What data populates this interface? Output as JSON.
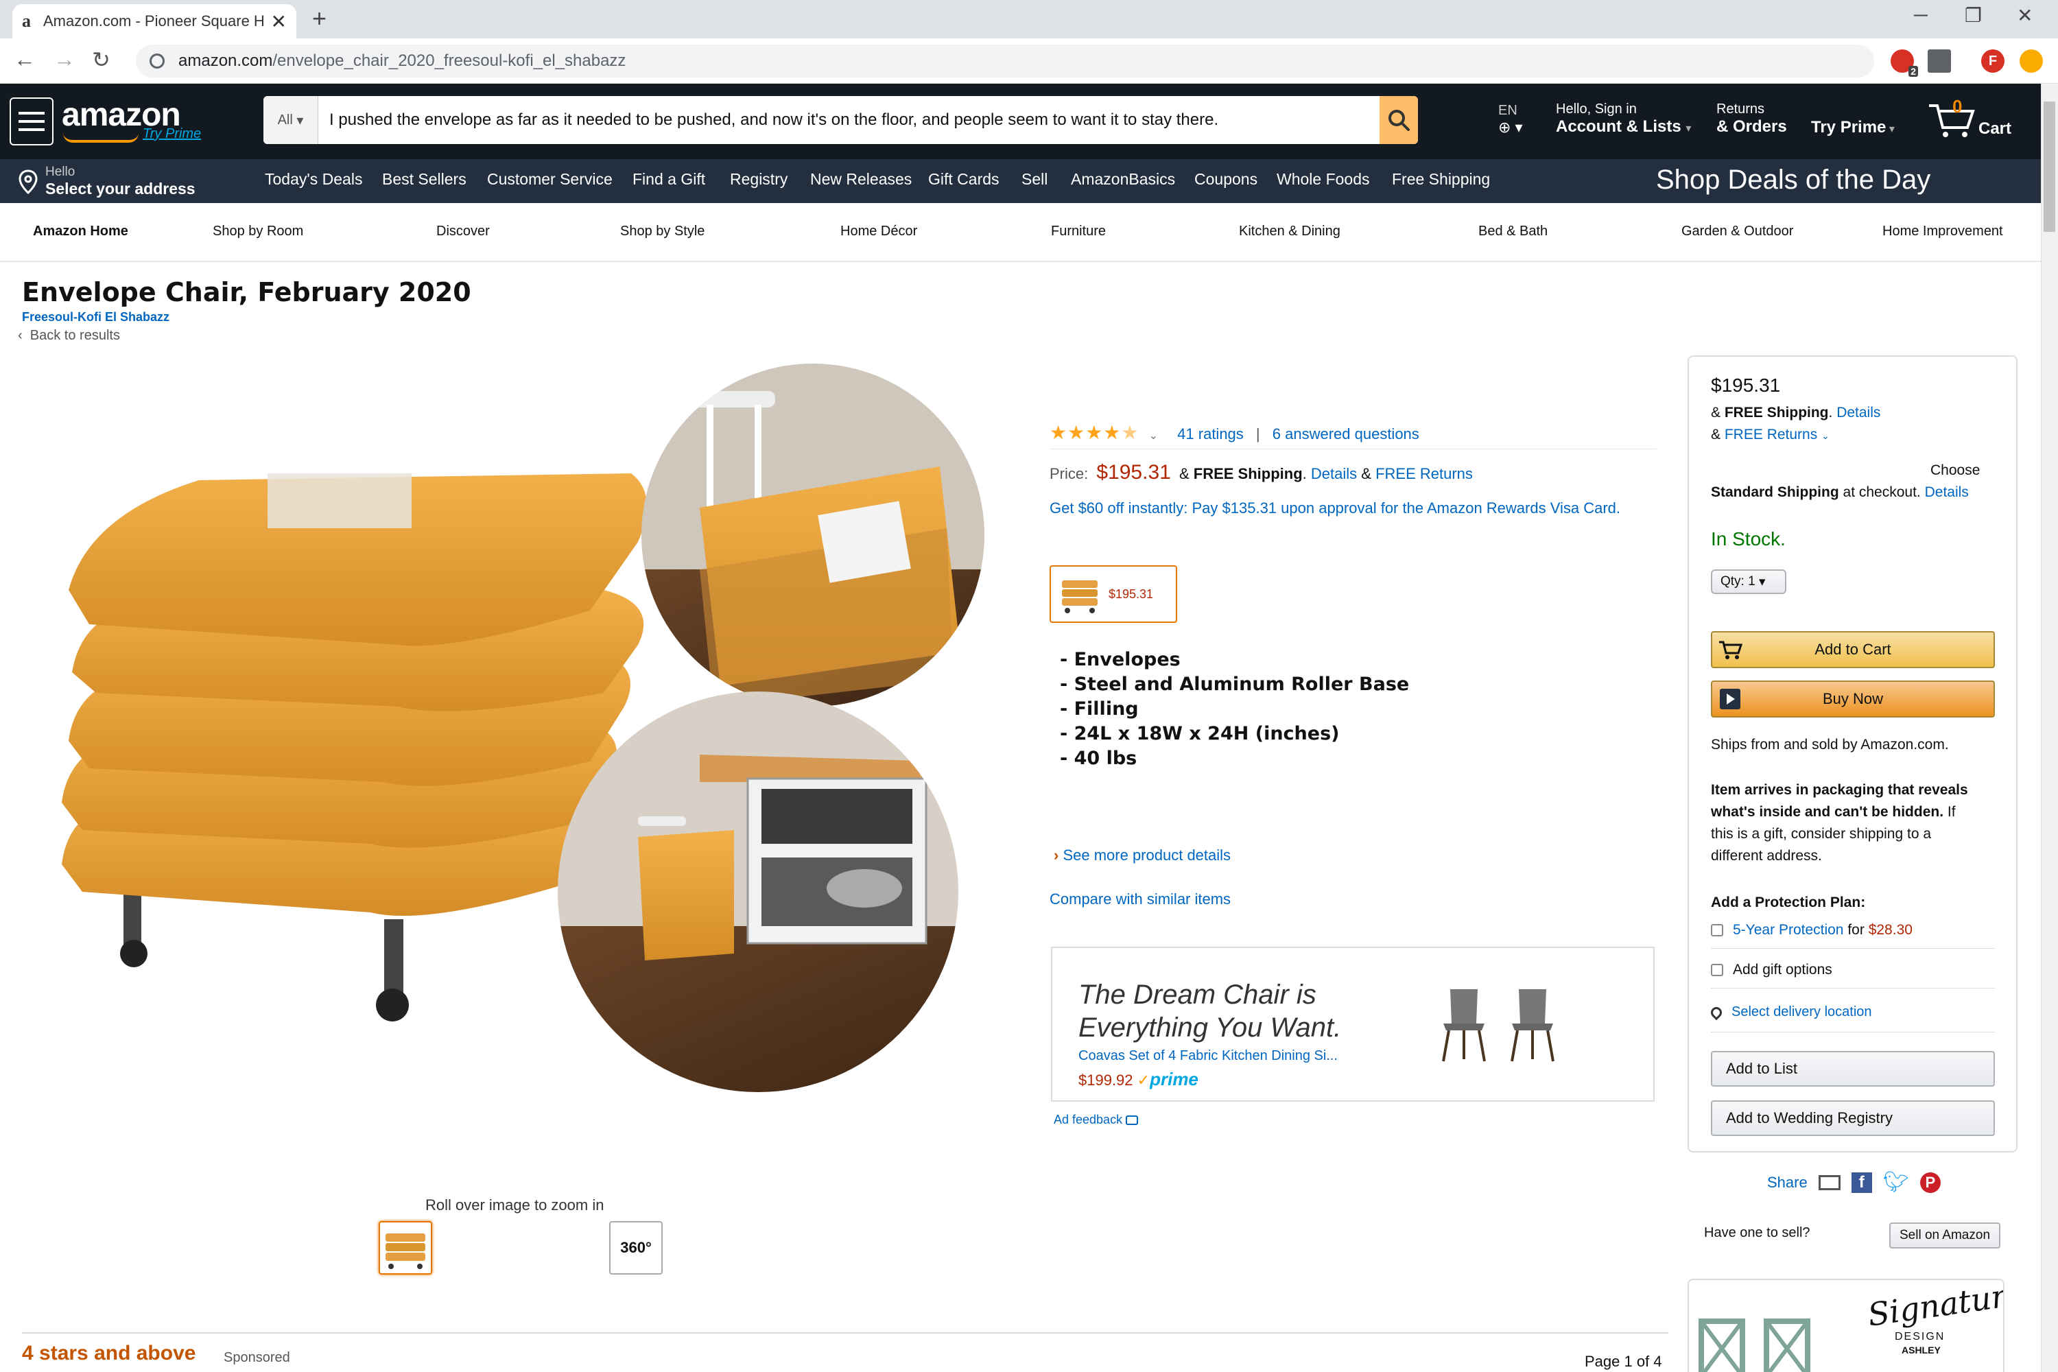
{
  "browser": {
    "tab_title": "Amazon.com - Pioneer Square H",
    "tab_favicon": "a",
    "url_host": "amazon.com",
    "url_path": "/envelope_chair_2020_freesoul-kofi_el_shabazz",
    "ext_badge": "2",
    "profile_initial": "F"
  },
  "header": {
    "logo": "amazon",
    "logo_sub": "Try Prime",
    "search_dept": "All",
    "search_value": "I pushed the envelope as far as it needed to be pushed, and now it's on the floor, and people seem to want it to stay there.",
    "lang": "EN",
    "account_small": "Hello, Sign in",
    "account_big": "Account & Lists",
    "returns_small": "Returns",
    "returns_big": "& Orders",
    "prime": "Try Prime",
    "cart_count": "0",
    "cart_label": "Cart"
  },
  "subnav": {
    "hello": "Hello",
    "address": "Select your address",
    "items": [
      "Today's Deals",
      "Best Sellers",
      "Customer Service",
      "Find a Gift",
      "Registry",
      "New Releases",
      "Gift Cards",
      "Sell",
      "AmazonBasics",
      "Coupons",
      "Whole Foods",
      "Free Shipping"
    ],
    "banner": "Shop Deals of the Day"
  },
  "categories": [
    "Amazon Home",
    "Shop by Room",
    "Discover",
    "Shop by Style",
    "Home Décor",
    "Furniture",
    "Kitchen & Dining",
    "Bed & Bath",
    "Garden & Outdoor",
    "Home Improvement"
  ],
  "product": {
    "title": "Envelope Chair, February 2020",
    "brand": "Freesoul-Kofi El Shabazz",
    "back": "Back to results",
    "ratings": "41 ratings",
    "sep": "|",
    "questions": "6 answered questions",
    "rating_value": 4.5,
    "price_label": "Price:",
    "price": "$195.31",
    "amp": "&",
    "free_shipping": "FREE Shipping",
    "details": "Details",
    "free_returns": "FREE Returns",
    "rewards": "Get $60 off instantly: Pay $135.31 upon approval for the Amazon Rewards Visa Card.",
    "swatch_price": "$195.31",
    "features": [
      "- Envelopes",
      "- Steel and Aluminum Roller Base",
      "- Filling",
      "- 24L x 18W x 24H (inches)",
      "- 40 lbs"
    ],
    "see_more": "See more product details",
    "compare": "Compare with similar items",
    "rollover": "Roll over image to zoom in",
    "thumb_360": "360°"
  },
  "ad": {
    "headline1": "The Dream Chair is",
    "headline2": "Everything You Want.",
    "product": "Coavas Set of 4 Fabric Kitchen Dining Si...",
    "price": "$199.92",
    "prime": "prime",
    "feedback": "Ad feedback"
  },
  "buybox": {
    "price": "$195.31",
    "shipping_amp": "&",
    "free_shipping": "FREE Shipping",
    "details": "Details",
    "free_returns": "FREE Returns",
    "choose": "Choose",
    "standard": "Standard Shipping",
    "at_checkout": "at checkout.",
    "stock": "In Stock.",
    "qty": "Qty:  1",
    "add_to_cart": "Add to Cart",
    "buy_now": "Buy Now",
    "ships": "Ships from and sold by Amazon.com.",
    "pkg1": "Item arrives in packaging that reveals",
    "pkg2": "what's inside and can't be hidden.",
    "pkg2b": "If",
    "pkg3": "this is a gift, consider shipping to a",
    "pkg4": "different address.",
    "protection_label": "Add a Protection Plan:",
    "protection": "5-Year Protection",
    "for": "for",
    "protection_price": "$28.30",
    "gift": "Add gift options",
    "delivery": "Select delivery location",
    "add_list": "Add to List",
    "add_wedding": "Add to Wedding Registry"
  },
  "share": {
    "label": "Share"
  },
  "sell": {
    "question": "Have one to sell?",
    "button": "Sell on Amazon"
  },
  "bottom": {
    "stars": "4 stars and above",
    "sponsored": "Sponsored",
    "page": "Page 1 of 4"
  },
  "signature": {
    "script": "Signature",
    "sub1": "DESIGN",
    "sub2": "ASHLEY"
  },
  "colors": {
    "amazon_dark": "#131921",
    "amazon_nav": "#232f3e",
    "accent": "#ff9900",
    "price": "#b12704",
    "link": "#0066c0",
    "stock": "#007600"
  }
}
